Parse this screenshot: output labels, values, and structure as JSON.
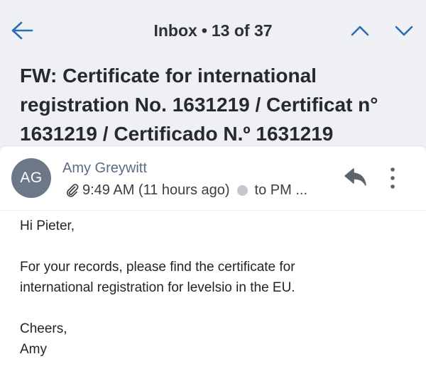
{
  "header": {
    "mailbox": "Inbox",
    "separator": "•",
    "position": "13 of 37",
    "back_icon": "arrow-left-icon",
    "prev_icon": "chevron-up-icon",
    "next_icon": "chevron-down-icon",
    "accent_color": "#2a6db7"
  },
  "subject": "FW: Certificate for international registration No. 1631219 / Certificat n° 1631219 / Certificado N.º 1631219",
  "message": {
    "avatar_initials": "AG",
    "sender": "Amy Greywitt",
    "attachment_icon": "paperclip-icon",
    "time": "9:49 AM (11 hours ago)",
    "recipient": "to PM ...",
    "reply_icon": "reply-icon",
    "more_icon": "more-vertical-icon"
  },
  "body": {
    "greeting": "Hi Pieter,",
    "line1": "For your records, please find the certificate for",
    "line2": "international registration for levelsio in the EU.",
    "closing": "Cheers,",
    "signature": "Amy"
  }
}
